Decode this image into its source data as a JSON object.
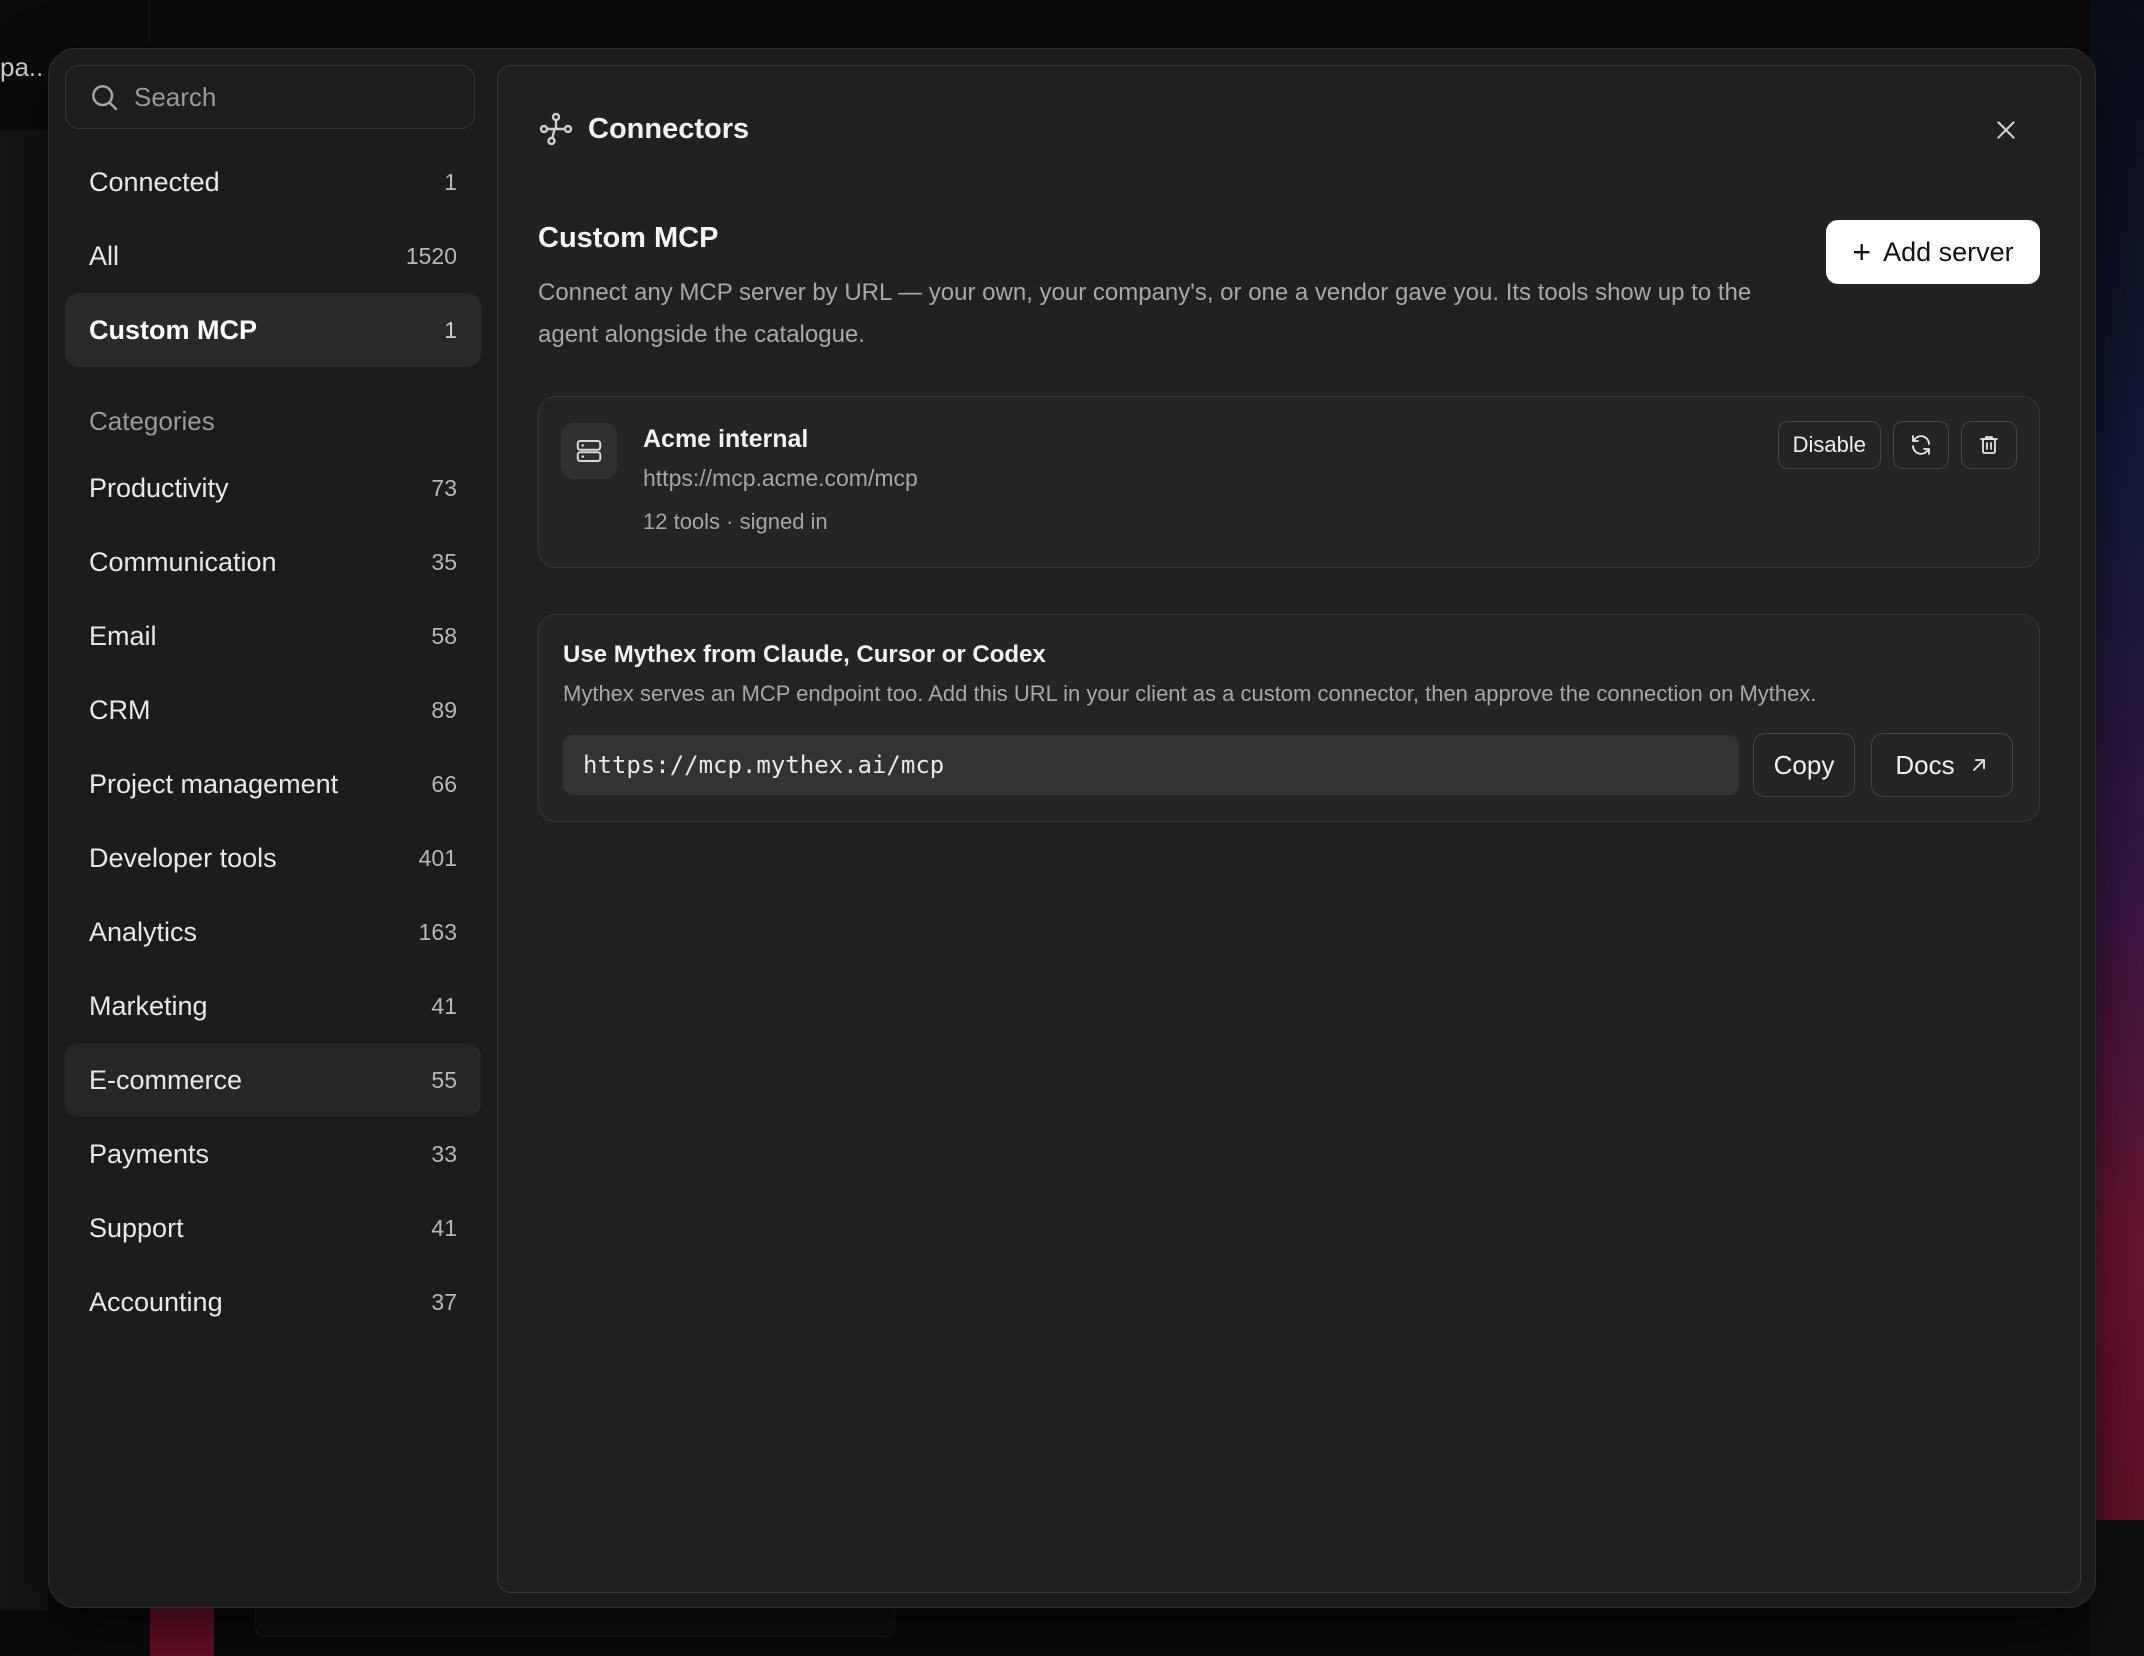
{
  "background": {
    "crumb_text": "pa.."
  },
  "sidebar": {
    "search_placeholder": "Search",
    "top_items": [
      {
        "label": "Connected",
        "count": "1"
      },
      {
        "label": "All",
        "count": "1520"
      },
      {
        "label": "Custom MCP",
        "count": "1",
        "active": true
      }
    ],
    "categories_label": "Categories",
    "categories": [
      {
        "label": "Productivity",
        "count": "73"
      },
      {
        "label": "Communication",
        "count": "35"
      },
      {
        "label": "Email",
        "count": "58"
      },
      {
        "label": "CRM",
        "count": "89"
      },
      {
        "label": "Project management",
        "count": "66"
      },
      {
        "label": "Developer tools",
        "count": "401"
      },
      {
        "label": "Analytics",
        "count": "163"
      },
      {
        "label": "Marketing",
        "count": "41"
      },
      {
        "label": "E-commerce",
        "count": "55"
      },
      {
        "label": "Payments",
        "count": "33"
      },
      {
        "label": "Support",
        "count": "41"
      },
      {
        "label": "Accounting",
        "count": "37"
      }
    ]
  },
  "header": {
    "title": "Connectors",
    "icon": "connectors-icon"
  },
  "custom_mcp": {
    "title": "Custom MCP",
    "description": "Connect any MCP server by URL — your own, your company's, or one a vendor gave you. Its tools show up to the agent alongside the catalogue.",
    "add_button_label": "Add server"
  },
  "server": {
    "name": "Acme internal",
    "url": "https://mcp.acme.com/mcp",
    "meta": "12 tools · signed in",
    "disable_label": "Disable"
  },
  "endpoint": {
    "title": "Use Mythex from Claude, Cursor or Codex",
    "description": "Mythex serves an MCP endpoint too. Add this URL in your client as a custom connector, then approve the connection on Mythex.",
    "url": "https://mcp.mythex.ai/mcp",
    "copy_label": "Copy",
    "docs_label": "Docs"
  },
  "colors": {
    "accent_button_bg": "#ffffff",
    "modal_bg": "#1c1c1c",
    "panel_bg": "#212121"
  }
}
